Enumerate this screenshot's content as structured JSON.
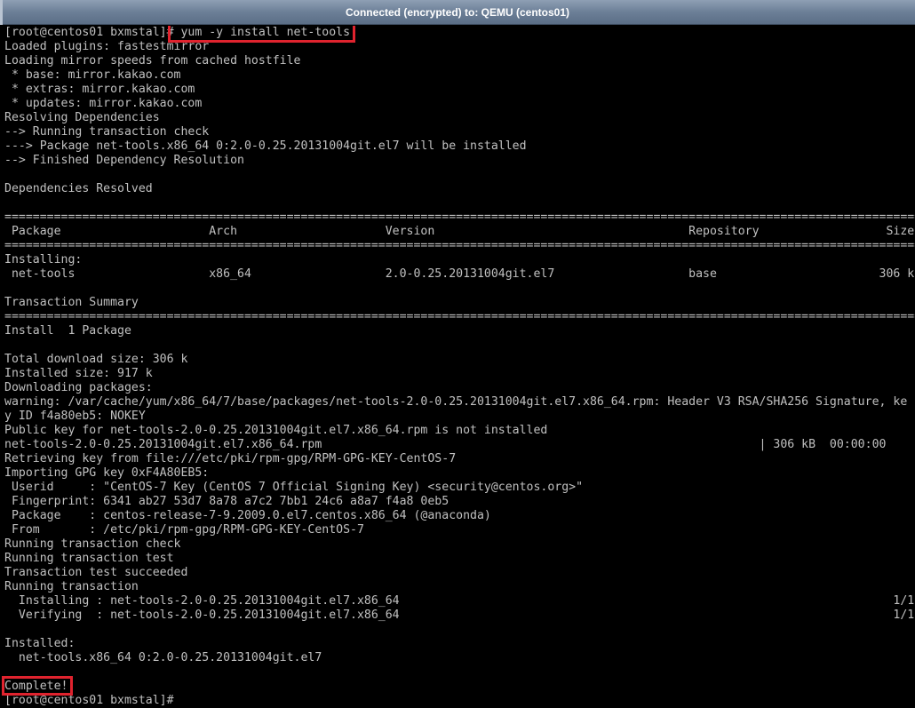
{
  "window": {
    "title": "Connected (encrypted) to: QEMU (centos01)"
  },
  "terminal": {
    "lines": [
      "[root@centos01 bxmstal]# yum -y install net-tools",
      "Loaded plugins: fastestmirror",
      "Loading mirror speeds from cached hostfile",
      " * base: mirror.kakao.com",
      " * extras: mirror.kakao.com",
      " * updates: mirror.kakao.com",
      "Resolving Dependencies",
      "--> Running transaction check",
      "---> Package net-tools.x86_64 0:2.0-0.25.20131004git.el7 will be installed",
      "--> Finished Dependency Resolution",
      "",
      "Dependencies Resolved",
      "",
      "==================================================================================================================================",
      " Package                     Arch                     Version                                    Repository                  Size",
      "==================================================================================================================================",
      "Installing:",
      " net-tools                   x86_64                   2.0-0.25.20131004git.el7                   base                       306 k",
      "",
      "Transaction Summary",
      "==================================================================================================================================",
      "Install  1 Package",
      "",
      "Total download size: 306 k",
      "Installed size: 917 k",
      "Downloading packages:",
      "warning: /var/cache/yum/x86_64/7/base/packages/net-tools-2.0-0.25.20131004git.el7.x86_64.rpm: Header V3 RSA/SHA256 Signature, ke",
      "y ID f4a80eb5: NOKEY",
      "Public key for net-tools-2.0-0.25.20131004git.el7.x86_64.rpm is not installed",
      "net-tools-2.0-0.25.20131004git.el7.x86_64.rpm                                                              | 306 kB  00:00:00",
      "Retrieving key from file:///etc/pki/rpm-gpg/RPM-GPG-KEY-CentOS-7",
      "Importing GPG key 0xF4A80EB5:",
      " Userid     : \"CentOS-7 Key (CentOS 7 Official Signing Key) <security@centos.org>\"",
      " Fingerprint: 6341 ab27 53d7 8a78 a7c2 7bb1 24c6 a8a7 f4a8 0eb5",
      " Package    : centos-release-7-9.2009.0.el7.centos.x86_64 (@anaconda)",
      " From       : /etc/pki/rpm-gpg/RPM-GPG-KEY-CentOS-7",
      "Running transaction check",
      "Running transaction test",
      "Transaction test succeeded",
      "Running transaction",
      "  Installing : net-tools-2.0-0.25.20131004git.el7.x86_64                                                                      1/1",
      "  Verifying  : net-tools-2.0-0.25.20131004git.el7.x86_64                                                                      1/1",
      "",
      "Installed:",
      "  net-tools.x86_64 0:2.0-0.25.20131004git.el7",
      "",
      "Complete!",
      "[root@centos01 bxmstal]#"
    ]
  },
  "colors": {
    "highlight": "#e0232e",
    "text": "#c0c0c0",
    "background": "#000000"
  }
}
